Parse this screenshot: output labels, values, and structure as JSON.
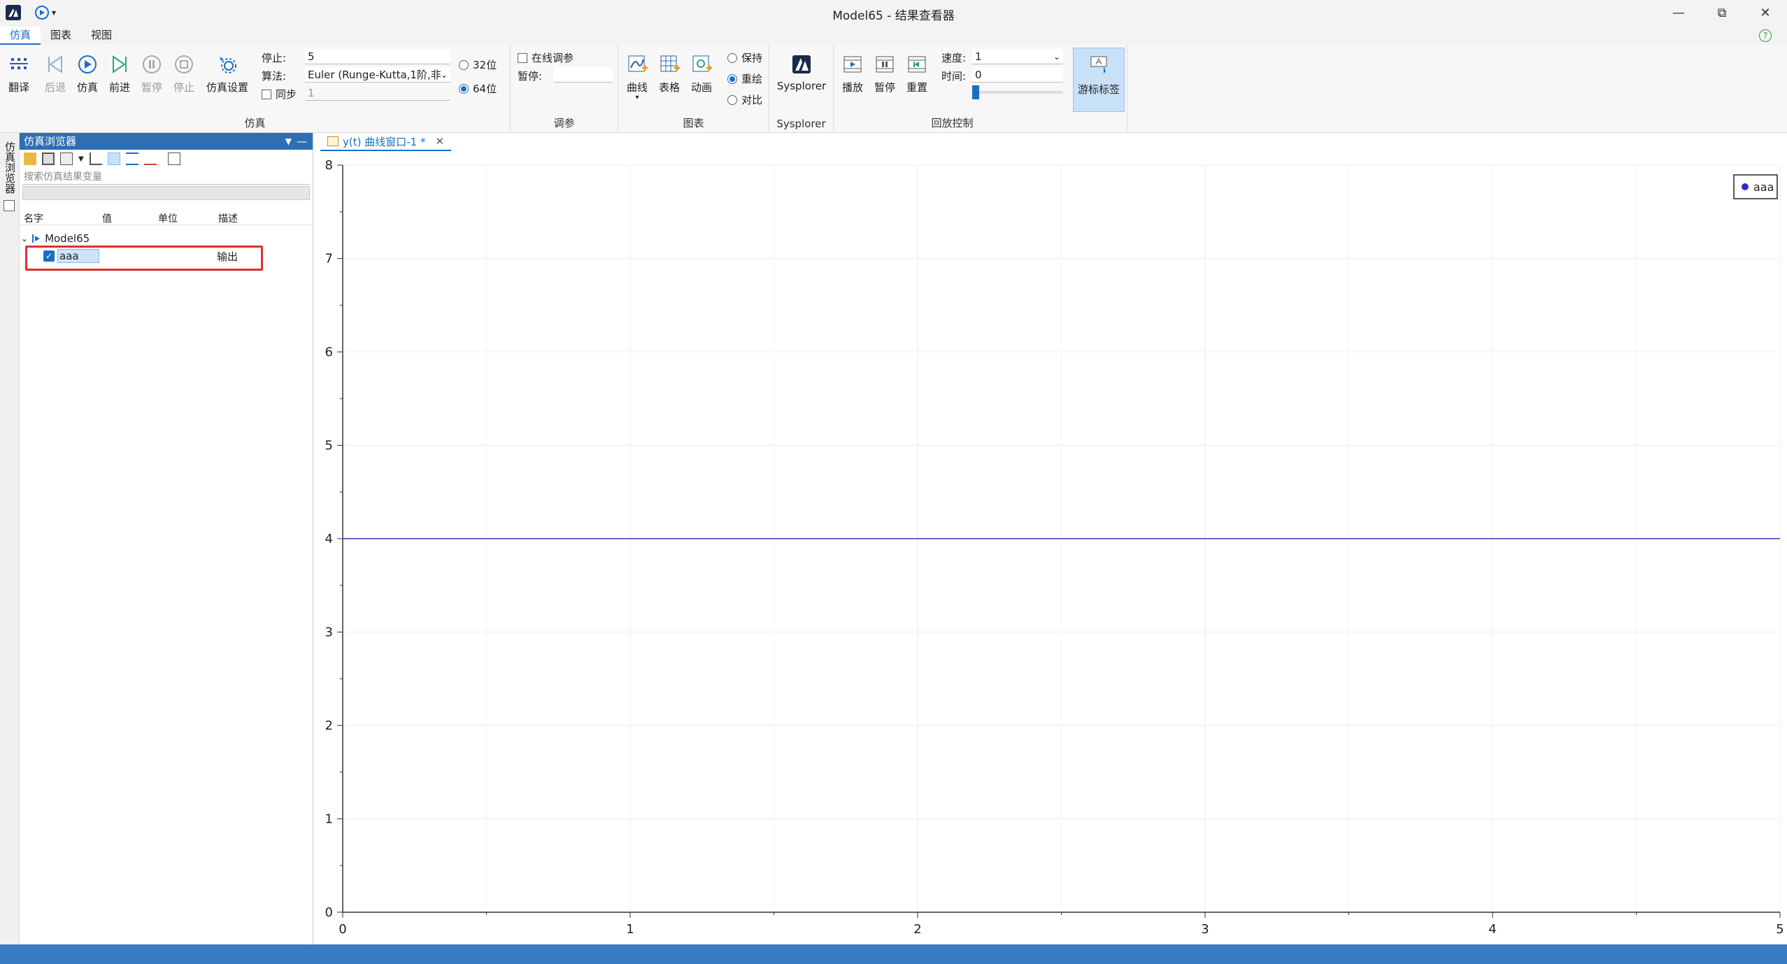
{
  "window": {
    "title": "Model65 - 结果查看器"
  },
  "menu": {
    "items": [
      "仿真",
      "图表",
      "视图"
    ]
  },
  "ribbon": {
    "sim_group": {
      "label": "仿真",
      "buttons": [
        "翻译",
        "后退",
        "仿真",
        "前进",
        "暂停",
        "停止",
        "仿真设置"
      ],
      "stop_label": "停止:",
      "stop_value": "5",
      "algo_label": "算法:",
      "algo_value": "Euler (Runge-Kutta,1阶,非",
      "sync_label": "同步",
      "sync_value": "1",
      "bits_32": "32位",
      "bits_64": "64位"
    },
    "tune_group": {
      "label": "调参",
      "online_label": "在线调参",
      "pause_label": "暂停:"
    },
    "chart_group": {
      "label": "图表",
      "buttons": [
        "曲线",
        "表格",
        "动画"
      ],
      "modes": [
        "保持",
        "重绘",
        "对比"
      ]
    },
    "sysplorer_group": {
      "label": "Sysplorer",
      "button": "Sysplorer"
    },
    "playback_group": {
      "label": "回放控制",
      "buttons": [
        "播放",
        "暂停",
        "重置"
      ],
      "speed_label": "速度:",
      "speed_value": "1",
      "time_label": "时间:",
      "time_value": "0",
      "cursor_label": "游标标签"
    }
  },
  "browser": {
    "side_tab": "仿真浏览器",
    "header": "仿真浏览器",
    "search_placeholder": "搜索仿真结果变量",
    "columns": [
      "名字",
      "值",
      "单位",
      "描述"
    ],
    "model": "Model65",
    "variable": {
      "name": "aaa",
      "desc": "输出"
    }
  },
  "doc_tab": {
    "label": "y(t) 曲线窗口-1 *"
  },
  "chart_data": {
    "type": "line",
    "series": [
      {
        "name": "aaa",
        "color": "#3030c0",
        "x": [
          0,
          5
        ],
        "y": [
          4,
          4
        ]
      }
    ],
    "xlim": [
      0,
      5
    ],
    "ylim": [
      0,
      8
    ],
    "xticks": [
      "0",
      "1",
      "2",
      "3",
      "4",
      "5"
    ],
    "yticks": [
      "0",
      "1",
      "2",
      "3",
      "4",
      "5",
      "6",
      "7",
      "8"
    ],
    "legend": "top-right",
    "grid": true
  }
}
